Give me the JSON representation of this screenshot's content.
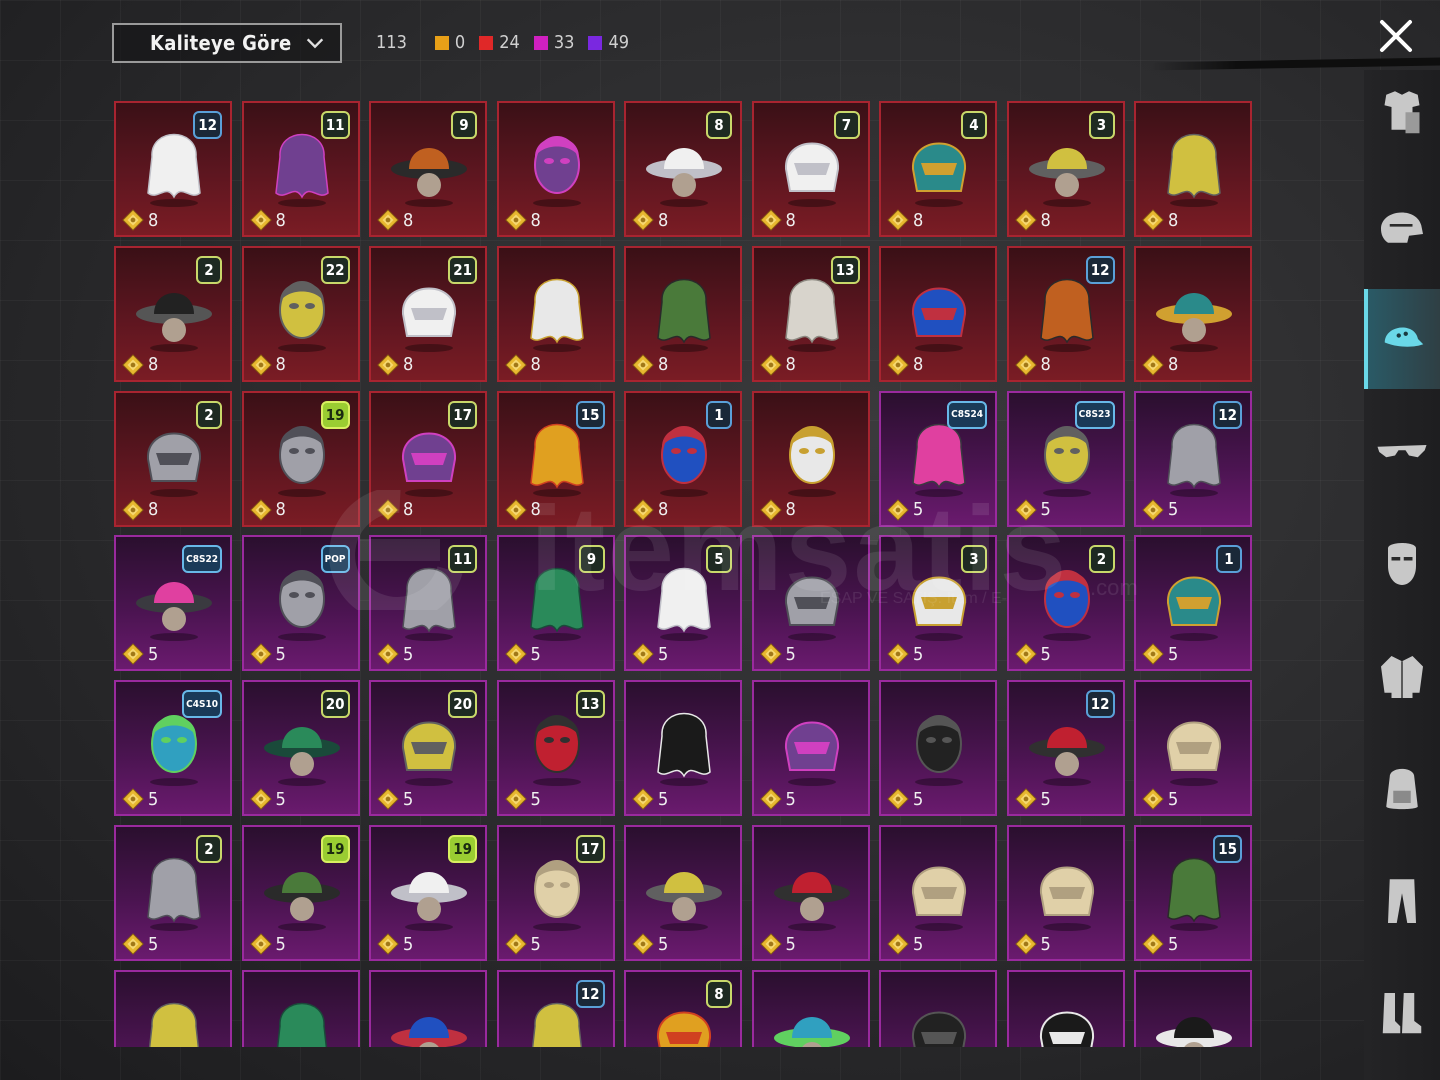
{
  "header": {
    "sort_label": "Kaliteye Göre",
    "total": "113",
    "counts": [
      {
        "color": "#e8a018",
        "value": "0"
      },
      {
        "color": "#e02828",
        "value": "24"
      },
      {
        "color": "#d020c0",
        "value": "33"
      },
      {
        "color": "#7a28e0",
        "value": "49"
      }
    ]
  },
  "watermark": {
    "text": "itemsatis",
    "sub": "ESAP VE SATIŞ: Item / E-",
    "com": ".com"
  },
  "rows": [
    [
      {
        "tier": "red",
        "badge": "12",
        "cost": "8",
        "icon": "white-hair-bun"
      },
      {
        "tier": "red",
        "badge": "11",
        "cost": "8",
        "icon": "black-hair"
      },
      {
        "tier": "red",
        "badge": "9",
        "cost": "8",
        "icon": "green-head-mohawk"
      },
      {
        "tier": "red",
        "badge": "",
        "cost": "8",
        "icon": "white-cowboy-hat"
      },
      {
        "tier": "red",
        "badge": "8",
        "cost": "8",
        "icon": "blonde-winged-hair"
      },
      {
        "tier": "red",
        "badge": "7",
        "cost": "8",
        "icon": "white-long-hair"
      },
      {
        "tier": "red",
        "badge": "4",
        "cost": "8",
        "icon": "snowman-top-hat"
      },
      {
        "tier": "red",
        "badge": "3",
        "cost": "8",
        "icon": "joker-green-hair"
      },
      {
        "tier": "red",
        "badge": "",
        "cost": "8",
        "icon": "teal-flame-helmet"
      }
    ],
    [
      {
        "tier": "red",
        "badge": "2",
        "cost": "8",
        "icon": "ice-bucket-hat"
      },
      {
        "tier": "red",
        "badge": "22",
        "cost": "8",
        "icon": "golden-pharaoh-headdress"
      },
      {
        "tier": "red",
        "badge": "21",
        "cost": "8",
        "icon": "white-hair-demon-mask"
      },
      {
        "tier": "red",
        "badge": "",
        "cost": "8",
        "icon": "red-horned-helmet"
      },
      {
        "tier": "red",
        "badge": "",
        "cost": "8",
        "icon": "red-space-helmet"
      },
      {
        "tier": "red",
        "badge": "13",
        "cost": "8",
        "icon": "pink-dreadlocks-mask"
      },
      {
        "tier": "red",
        "badge": "",
        "cost": "8",
        "icon": "anubis-mask"
      },
      {
        "tier": "red",
        "badge": "12",
        "cost": "8",
        "icon": "golden-winged-helmet"
      },
      {
        "tier": "red",
        "badge": "",
        "cost": "8",
        "icon": "black-cat-helmet"
      }
    ],
    [
      {
        "tier": "red",
        "badge": "2",
        "cost": "8",
        "icon": "blue-samurai-helmet"
      },
      {
        "tier": "red",
        "badge": "19",
        "cost": "8",
        "icon": "red-oni-samurai"
      },
      {
        "tier": "red",
        "badge": "17",
        "cost": "8",
        "icon": "black-gold-ninja"
      },
      {
        "tier": "red",
        "badge": "15",
        "cost": "8",
        "icon": "purple-visor-helmet"
      },
      {
        "tier": "red",
        "badge": "1",
        "cost": "8",
        "icon": "blue-red-alien-mask"
      },
      {
        "tier": "red",
        "badge": "",
        "cost": "8",
        "icon": "silver-football-helmet"
      },
      {
        "tier": "purple",
        "badge": "C8S24",
        "cost": "5",
        "icon": "black-bob-hair"
      },
      {
        "tier": "purple",
        "badge": "C8S23",
        "cost": "5",
        "icon": "cat-ear-headphones"
      },
      {
        "tier": "purple",
        "badge": "12",
        "cost": "5",
        "icon": "orange-pigtails"
      }
    ],
    [
      {
        "tier": "purple",
        "badge": "C8S22",
        "cost": "5",
        "icon": "purple-teal-hair"
      },
      {
        "tier": "purple",
        "badge": "POP",
        "cost": "5",
        "icon": "panda-mask"
      },
      {
        "tier": "purple",
        "badge": "11",
        "cost": "5",
        "icon": "flower-crown-grey-hair"
      },
      {
        "tier": "purple",
        "badge": "9",
        "cost": "5",
        "icon": "dark-long-hair"
      },
      {
        "tier": "purple",
        "badge": "5",
        "cost": "5",
        "icon": "brown-bow-hair"
      },
      {
        "tier": "purple",
        "badge": "",
        "cost": "5",
        "icon": "blonde-curly-hair"
      },
      {
        "tier": "purple",
        "badge": "3",
        "cost": "5",
        "icon": "jester-hat"
      },
      {
        "tier": "purple",
        "badge": "2",
        "cost": "5",
        "icon": "headband-blonde-hair"
      },
      {
        "tier": "purple",
        "badge": "1",
        "cost": "5",
        "icon": "pastel-pigtails"
      }
    ],
    [
      {
        "tier": "purple",
        "badge": "C4S10",
        "cost": "5",
        "icon": "green-knight-helmet"
      },
      {
        "tier": "purple",
        "badge": "20",
        "cost": "5",
        "icon": "feather-hat-blonde"
      },
      {
        "tier": "purple",
        "badge": "20",
        "cost": "5",
        "icon": "gold-red-mask"
      },
      {
        "tier": "purple",
        "badge": "13",
        "cost": "5",
        "icon": "devil-horn-cap"
      },
      {
        "tier": "purple",
        "badge": "",
        "cost": "5",
        "icon": "gold-feather-helmet"
      },
      {
        "tier": "purple",
        "badge": "",
        "cost": "5",
        "icon": "duck-headphones"
      },
      {
        "tier": "purple",
        "badge": "",
        "cost": "5",
        "icon": "straw-boater-hat"
      },
      {
        "tier": "purple",
        "badge": "12",
        "cost": "5",
        "icon": "yellow-can-head"
      },
      {
        "tier": "purple",
        "badge": "",
        "cost": "5",
        "icon": "silver-conehead"
      }
    ],
    [
      {
        "tier": "purple",
        "badge": "2",
        "cost": "5",
        "icon": "mesh-veil-helmet"
      },
      {
        "tier": "purple",
        "badge": "19",
        "cost": "5",
        "icon": "cat-ear-grey-hair"
      },
      {
        "tier": "purple",
        "badge": "19",
        "cost": "5",
        "icon": "bug-eye-helmet"
      },
      {
        "tier": "purple",
        "badge": "17",
        "cost": "5",
        "icon": "black-hood-mask"
      },
      {
        "tier": "purple",
        "badge": "",
        "cost": "5",
        "icon": "white-dreadlocks"
      },
      {
        "tier": "purple",
        "badge": "",
        "cost": "5",
        "icon": "animal-head-cap"
      },
      {
        "tier": "purple",
        "badge": "",
        "cost": "5",
        "icon": "spiked-mask"
      },
      {
        "tier": "purple",
        "badge": "",
        "cost": "5",
        "icon": "frog-goggles"
      },
      {
        "tier": "purple",
        "badge": "15",
        "cost": "5",
        "icon": "blue-tactical-helmet"
      }
    ],
    [
      {
        "tier": "purple",
        "badge": "",
        "cost": "",
        "icon": "antler-headband"
      },
      {
        "tier": "purple",
        "badge": "",
        "cost": "",
        "icon": "red-horns"
      },
      {
        "tier": "purple",
        "badge": "",
        "cost": "",
        "icon": "white-sun-hat"
      },
      {
        "tier": "purple",
        "badge": "12",
        "cost": "",
        "icon": "bunny-ears"
      },
      {
        "tier": "purple",
        "badge": "8",
        "cost": "",
        "icon": "green-mask-hood"
      },
      {
        "tier": "purple",
        "badge": "",
        "cost": "",
        "icon": "dark-green-helmet"
      },
      {
        "tier": "purple",
        "badge": "",
        "cost": "",
        "icon": "black-motor-helmet"
      },
      {
        "tier": "purple",
        "badge": "",
        "cost": "",
        "icon": "aviator-goggles"
      },
      {
        "tier": "purple",
        "badge": "",
        "cost": "",
        "icon": "red-white-cap"
      }
    ]
  ],
  "sidebar": [
    {
      "icon": "outfit-icon",
      "active": false
    },
    {
      "icon": "helmet-icon",
      "active": false
    },
    {
      "icon": "cap-icon",
      "active": true
    },
    {
      "icon": "sunglasses-icon",
      "active": false
    },
    {
      "icon": "mask-icon",
      "active": false
    },
    {
      "icon": "jacket-icon",
      "active": false
    },
    {
      "icon": "backpack-icon",
      "active": false
    },
    {
      "icon": "pants-icon",
      "active": false
    },
    {
      "icon": "boots-icon",
      "active": false
    }
  ]
}
